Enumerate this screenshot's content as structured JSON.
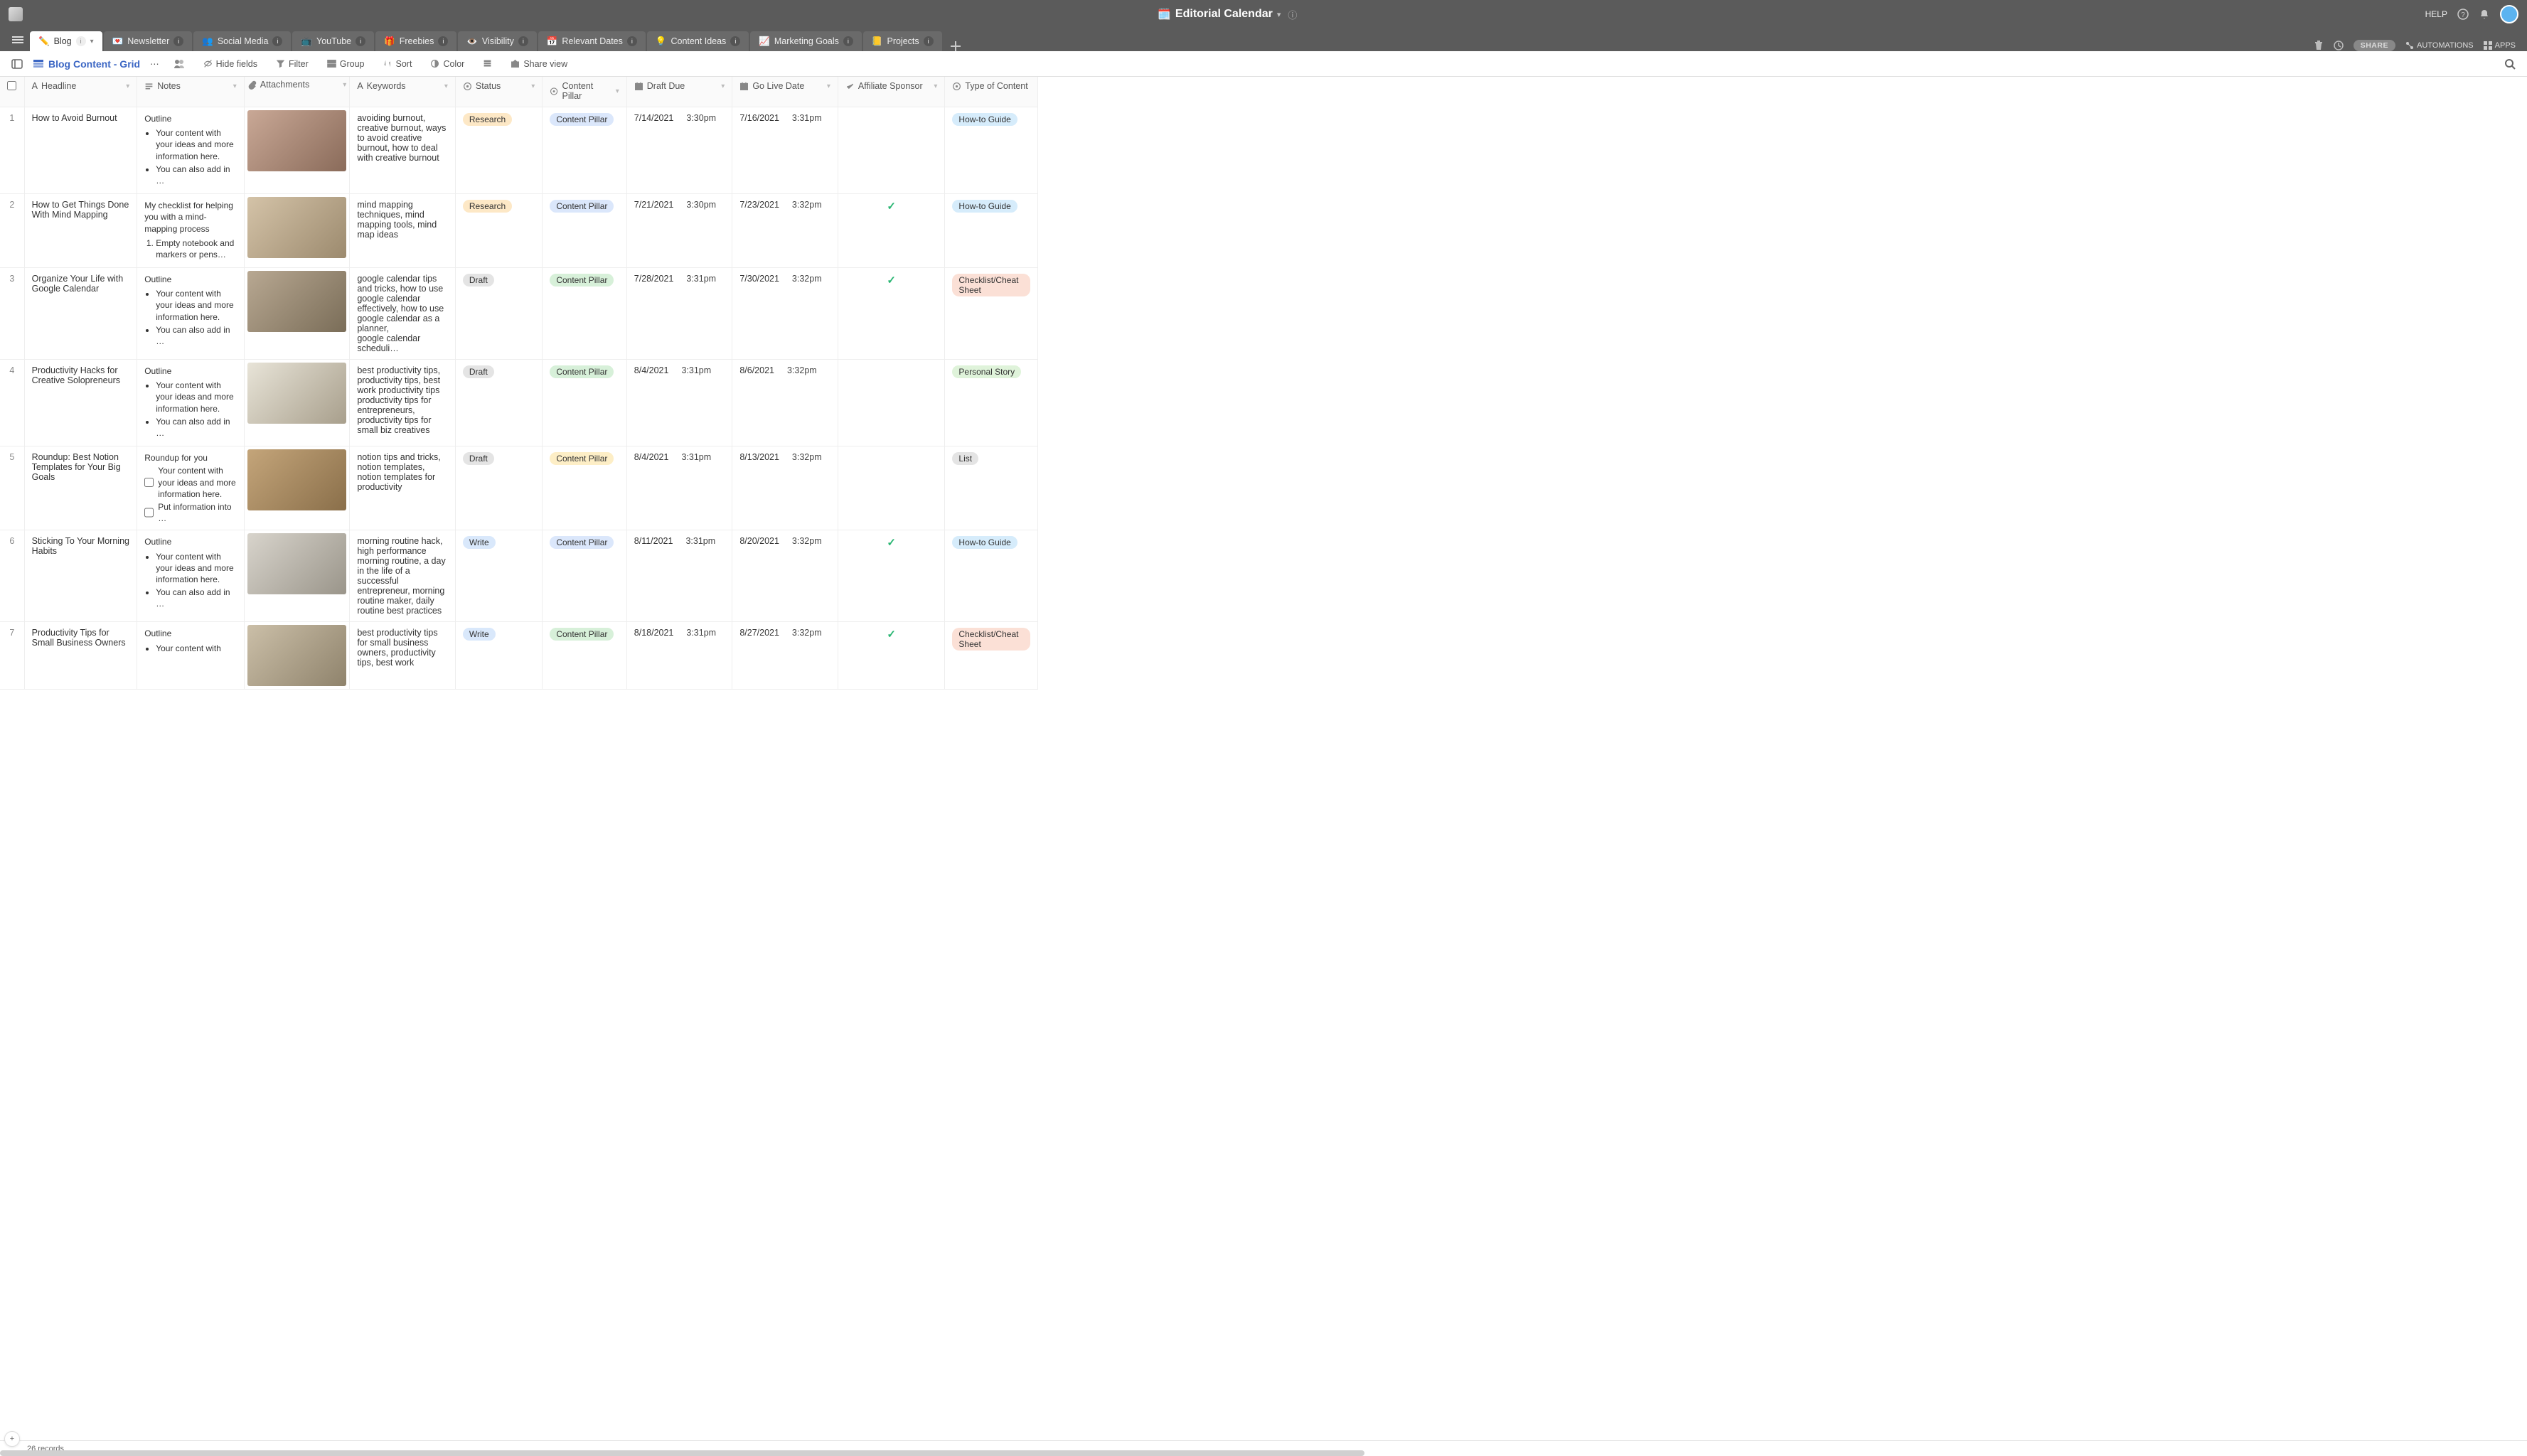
{
  "topbar": {
    "title": "Editorial Calendar",
    "help": "HELP",
    "right_icons": [
      "help-circle",
      "bell",
      "avatar"
    ]
  },
  "tabs": [
    {
      "emoji": "✏️",
      "label": "Blog",
      "active": true
    },
    {
      "emoji": "💌",
      "label": "Newsletter"
    },
    {
      "emoji": "👥",
      "label": "Social Media"
    },
    {
      "emoji": "📺",
      "label": "YouTube"
    },
    {
      "emoji": "🎁",
      "label": "Freebies"
    },
    {
      "emoji": "👁️",
      "label": "Visibility"
    },
    {
      "emoji": "📅",
      "label": "Relevant Dates"
    },
    {
      "emoji": "💡",
      "label": "Content Ideas"
    },
    {
      "emoji": "📈",
      "label": "Marketing Goals"
    },
    {
      "emoji": "📒",
      "label": "Projects"
    }
  ],
  "tabbar_right": {
    "share": "SHARE",
    "automations": "AUTOMATIONS",
    "apps": "APPS"
  },
  "viewbar": {
    "view_name": "Blog Content - Grid",
    "hide_fields": "Hide fields",
    "filter": "Filter",
    "group": "Group",
    "sort": "Sort",
    "color": "Color",
    "share_view": "Share view"
  },
  "columns": [
    {
      "key": "headline",
      "label": "Headline",
      "icon": "A"
    },
    {
      "key": "notes",
      "label": "Notes",
      "icon": "rtf"
    },
    {
      "key": "attach",
      "label": "Attachments",
      "icon": "attach"
    },
    {
      "key": "keywords",
      "label": "Keywords",
      "icon": "A"
    },
    {
      "key": "status",
      "label": "Status",
      "icon": "select"
    },
    {
      "key": "pillar",
      "label": "Content Pillar",
      "icon": "select"
    },
    {
      "key": "draft",
      "label": "Draft Due",
      "icon": "cal"
    },
    {
      "key": "live",
      "label": "Go Live Date",
      "icon": "cal"
    },
    {
      "key": "aff",
      "label": "Affiliate Sponsor",
      "icon": "check"
    },
    {
      "key": "type",
      "label": "Type of Content",
      "icon": "select"
    }
  ],
  "status_colors": {
    "Research": "#fde8c6",
    "Draft": "#e4e4e4",
    "Write": "#d9e8fb"
  },
  "pillar_colors": {
    "Content Pillar_blue": "#dbe7fb",
    "Content Pillar_green": "#d7f0d9",
    "Content Pillar_yellow": "#fdeec6"
  },
  "type_colors": {
    "How-to Guide": "#d6ecfb",
    "Checklist/Cheat Sheet": "#fbe0d6",
    "Personal Story": "#dff3da",
    "List": "#e4e4e4"
  },
  "rows": [
    {
      "n": "1",
      "headline": "How to Avoid Burnout",
      "notes_title": "Outline",
      "notes_items": [
        "Your content with your ideas and more information here.",
        "You can also add in …"
      ],
      "notes_type": "ul",
      "thumb": "linear-gradient(135deg,#c9a896,#8a6b5a)",
      "keywords": "avoiding burnout, creative burnout, ways to avoid creative burnout, how to deal with creative burnout",
      "status": "Research",
      "status_bg": "#fde8c6",
      "pillar": "Content Pillar",
      "pillar_bg": "#dbe7fb",
      "draft_date": "7/14/2021",
      "draft_time": "3:30pm",
      "live_date": "7/16/2021",
      "live_time": "3:31pm",
      "aff": false,
      "type": "How-to Guide",
      "type_bg": "#d6ecfb"
    },
    {
      "n": "2",
      "headline": "How to Get Things Done With Mind Mapping",
      "notes_title": "My checklist for helping you with a mind-mapping process",
      "notes_items": [
        "Empty notebook and markers or pens…"
      ],
      "notes_type": "ol",
      "thumb": "linear-gradient(135deg,#d4c3a8,#9c8a6e)",
      "keywords": "mind mapping techniques, mind mapping tools, mind map ideas",
      "status": "Research",
      "status_bg": "#fde8c6",
      "pillar": "Content Pillar",
      "pillar_bg": "#dbe7fb",
      "draft_date": "7/21/2021",
      "draft_time": "3:30pm",
      "live_date": "7/23/2021",
      "live_time": "3:32pm",
      "aff": true,
      "type": "How-to Guide",
      "type_bg": "#d6ecfb"
    },
    {
      "n": "3",
      "headline": "Organize Your Life with Google Calendar",
      "notes_title": "Outline",
      "notes_items": [
        "Your content with your ideas and more information here.",
        "You can also add in …"
      ],
      "notes_type": "ul",
      "thumb": "linear-gradient(135deg,#b8a892,#7a6d58)",
      "keywords": "google calendar tips and tricks, how to use google calendar effectively, how to use google calendar as a planner,\ngoogle calendar scheduli…",
      "status": "Draft",
      "status_bg": "#e4e4e4",
      "pillar": "Content Pillar",
      "pillar_bg": "#d7f0d9",
      "draft_date": "7/28/2021",
      "draft_time": "3:31pm",
      "live_date": "7/30/2021",
      "live_time": "3:32pm",
      "aff": true,
      "type": "Checklist/Cheat Sheet",
      "type_bg": "#fbe0d6"
    },
    {
      "n": "4",
      "headline": "Productivity Hacks for Creative Solopreneurs",
      "notes_title": "Outline",
      "notes_items": [
        "Your content with your ideas and more information here.",
        "You can also add in …"
      ],
      "notes_type": "ul",
      "thumb": "linear-gradient(135deg,#e8e4d8,#a89f8c)",
      "keywords": "best productivity tips, productivity tips, best work productivity tips\nproductivity tips for entrepreneurs, productivity tips for small biz creatives",
      "status": "Draft",
      "status_bg": "#e4e4e4",
      "pillar": "Content Pillar",
      "pillar_bg": "#d7f0d9",
      "draft_date": "8/4/2021",
      "draft_time": "3:31pm",
      "live_date": "8/6/2021",
      "live_time": "3:32pm",
      "aff": false,
      "type": "Personal Story",
      "type_bg": "#dff3da"
    },
    {
      "n": "5",
      "headline": "Roundup: Best Notion Templates for Your Big Goals",
      "notes_title": "Roundup for you",
      "notes_items": [
        "Your content with your ideas and more information here.",
        "Put information into …"
      ],
      "notes_type": "check",
      "thumb": "linear-gradient(135deg,#c4a57a,#8a6f4a)",
      "keywords": "notion tips and tricks, notion templates, notion templates for productivity",
      "status": "Draft",
      "status_bg": "#e4e4e4",
      "pillar": "Content Pillar",
      "pillar_bg": "#fdeec6",
      "draft_date": "8/4/2021",
      "draft_time": "3:31pm",
      "live_date": "8/13/2021",
      "live_time": "3:32pm",
      "aff": false,
      "type": "List",
      "type_bg": "#e4e4e4"
    },
    {
      "n": "6",
      "headline": "Sticking To Your Morning Habits",
      "notes_title": "Outline",
      "notes_items": [
        "Your content with your ideas and more information here.",
        "You can also add in …"
      ],
      "notes_type": "ul",
      "thumb": "linear-gradient(135deg,#d8d4cc,#9a958a)",
      "keywords": "morning routine hack, high performance morning routine, a day in the life of a successful entrepreneur, morning routine maker, daily routine best practices",
      "status": "Write",
      "status_bg": "#d9e8fb",
      "pillar": "Content Pillar",
      "pillar_bg": "#dbe7fb",
      "draft_date": "8/11/2021",
      "draft_time": "3:31pm",
      "live_date": "8/20/2021",
      "live_time": "3:32pm",
      "aff": true,
      "type": "How-to Guide",
      "type_bg": "#d6ecfb"
    },
    {
      "n": "7",
      "headline": "Productivity Tips for Small Business Owners",
      "notes_title": "Outline",
      "notes_items": [
        "Your content with"
      ],
      "notes_type": "ul",
      "thumb": "linear-gradient(135deg,#cbbfa8,#8f836c)",
      "keywords": "best productivity tips for small business owners, productivity tips, best work",
      "status": "Write",
      "status_bg": "#d9e8fb",
      "pillar": "Content Pillar",
      "pillar_bg": "#d7f0d9",
      "draft_date": "8/18/2021",
      "draft_time": "3:31pm",
      "live_date": "8/27/2021",
      "live_time": "3:32pm",
      "aff": true,
      "type": "Checklist/Cheat Sheet",
      "type_bg": "#fbe0d6"
    }
  ],
  "footer": {
    "records": "26 records"
  }
}
